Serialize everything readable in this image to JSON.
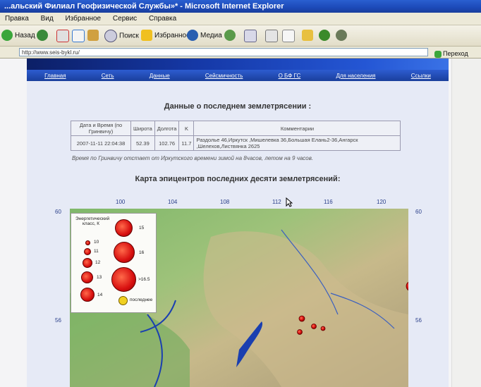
{
  "window": {
    "title": "...альский Филиал Геофизической Службы»* - Microsoft Internet Explorer"
  },
  "menu": [
    "Правка",
    "Вид",
    "Избранное",
    "Сервис",
    "Справка"
  ],
  "toolbar": {
    "back_label": "Назад",
    "search_label": "Поиск",
    "favorites_label": "Избранное",
    "media_label": "Медиа"
  },
  "address": {
    "url": "http://www.seis-bykl.ru/",
    "go_label": "Переход"
  },
  "site": {
    "nav": [
      "Главная",
      "Сеть",
      "Данные",
      "Сейсмичность",
      "О БФ ГС",
      "Для населения",
      "Ссылки"
    ],
    "latest_heading": "Данные о последнем землетрясении :",
    "table_headers": [
      "Дата и Время (по Гринвичу)",
      "Широта",
      "Долгота",
      "K",
      "Комментарии"
    ],
    "table_row": [
      "2007-11-11 22:04:38",
      "52.39",
      "102.76",
      "11.7",
      "Раздолье 46,Иркутск ,Мишелевка 36,Большая Елань2-36,Ангарск ,Шелехов,Листвянка 2625"
    ],
    "note": "Время по Гринвичу отстает от Иркутского времени зимой на 8часов, летом на 9 часов.",
    "map_heading": "Карта эпицентров последних десяти землетрясений:"
  },
  "map": {
    "lon_ticks": [
      "100",
      "104",
      "108",
      "112",
      "116",
      "120"
    ],
    "lat_ticks": [
      "60",
      "56"
    ],
    "legend": {
      "title": "Энергетический класс, К",
      "classes": [
        "10",
        "11",
        "12",
        "13",
        "14",
        "15",
        "16",
        ">16.5"
      ],
      "latest_label": "последнее"
    },
    "colors": {
      "epicenter": "#d81010",
      "latest": "#f0d020",
      "lake": "#1a3fb0"
    }
  }
}
